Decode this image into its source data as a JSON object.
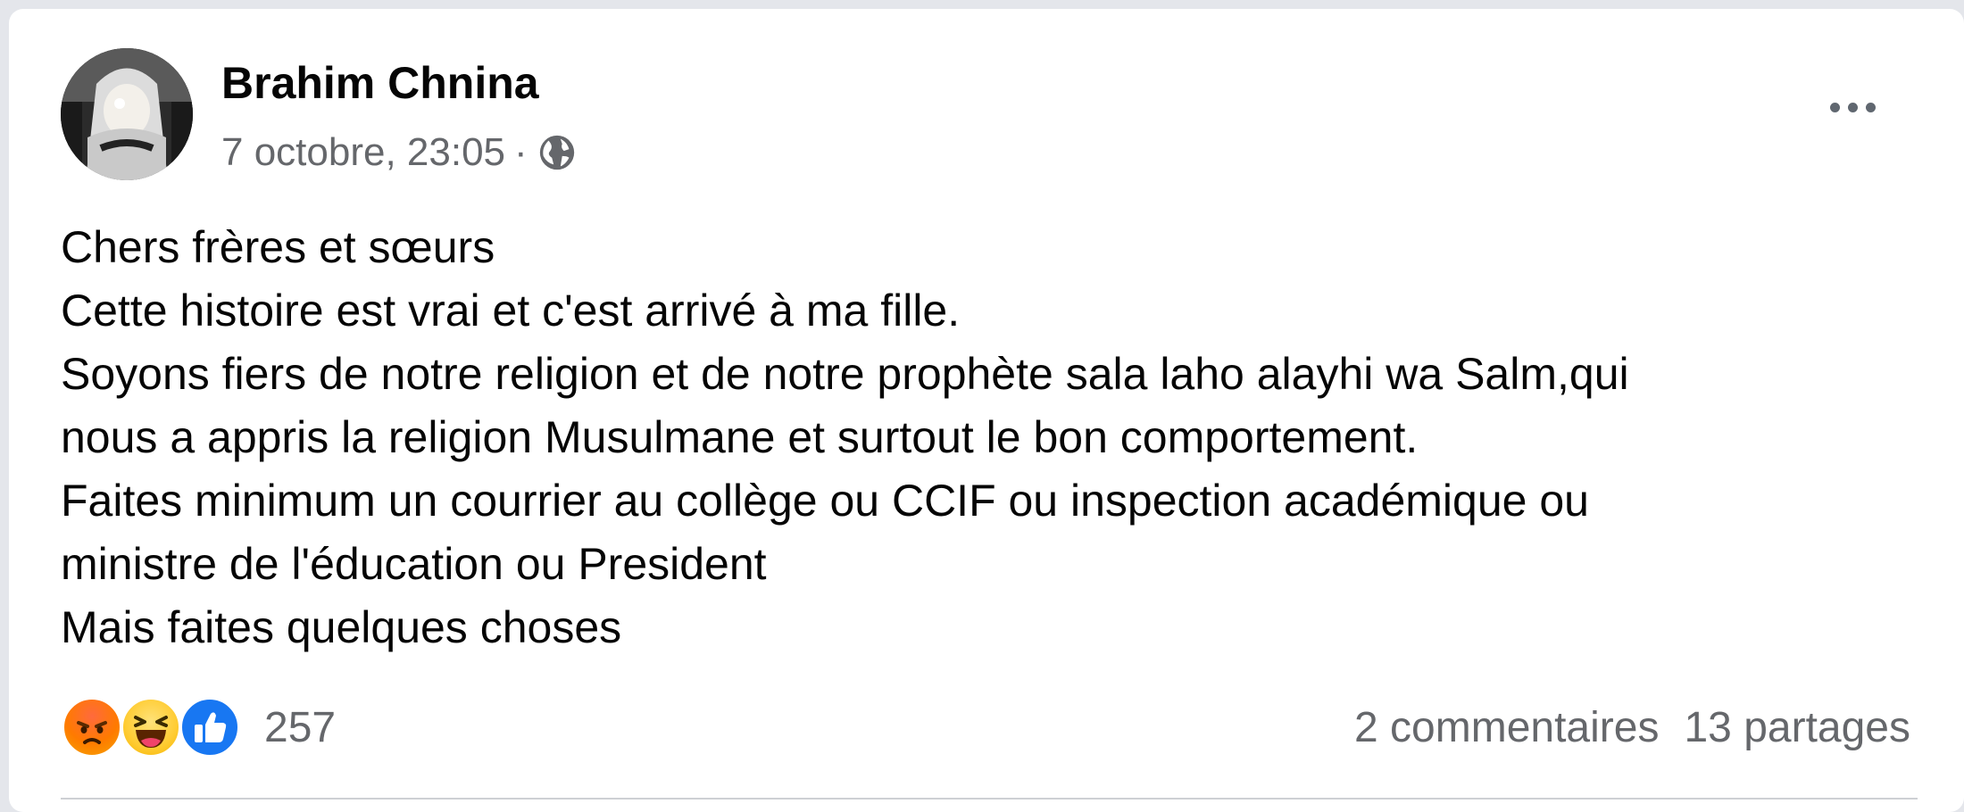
{
  "post": {
    "author": "Brahim Chnina",
    "timestamp": "7 octobre, 23:05",
    "separator": "·",
    "audience_icon": "globe-icon",
    "more_icon": "more-horizontal-icon",
    "body_lines": [
      "Chers frères et sœurs",
      "Cette histoire est vrai et c'est arrivé à ma fille.",
      "Soyons fiers de notre religion et de notre prophète sala laho alayhi wa Salm,qui",
      "nous a appris la religion Musulmane et surtout le bon comportement.",
      "Faites minimum un courrier au collège ou CCIF ou inspection académique ou",
      "ministre de l'éducation ou President",
      "Mais faites quelques choses"
    ]
  },
  "engagement": {
    "reactions": [
      "angry-reaction-icon",
      "haha-reaction-icon",
      "like-reaction-icon"
    ],
    "reaction_count": "257",
    "comments": "2 commentaires",
    "shares": "13 partages"
  },
  "colors": {
    "text_primary": "#050505",
    "text_secondary": "#65676b",
    "like_blue": "#1877f2",
    "card_bg": "#ffffff",
    "page_bg": "#e4e6eb"
  }
}
